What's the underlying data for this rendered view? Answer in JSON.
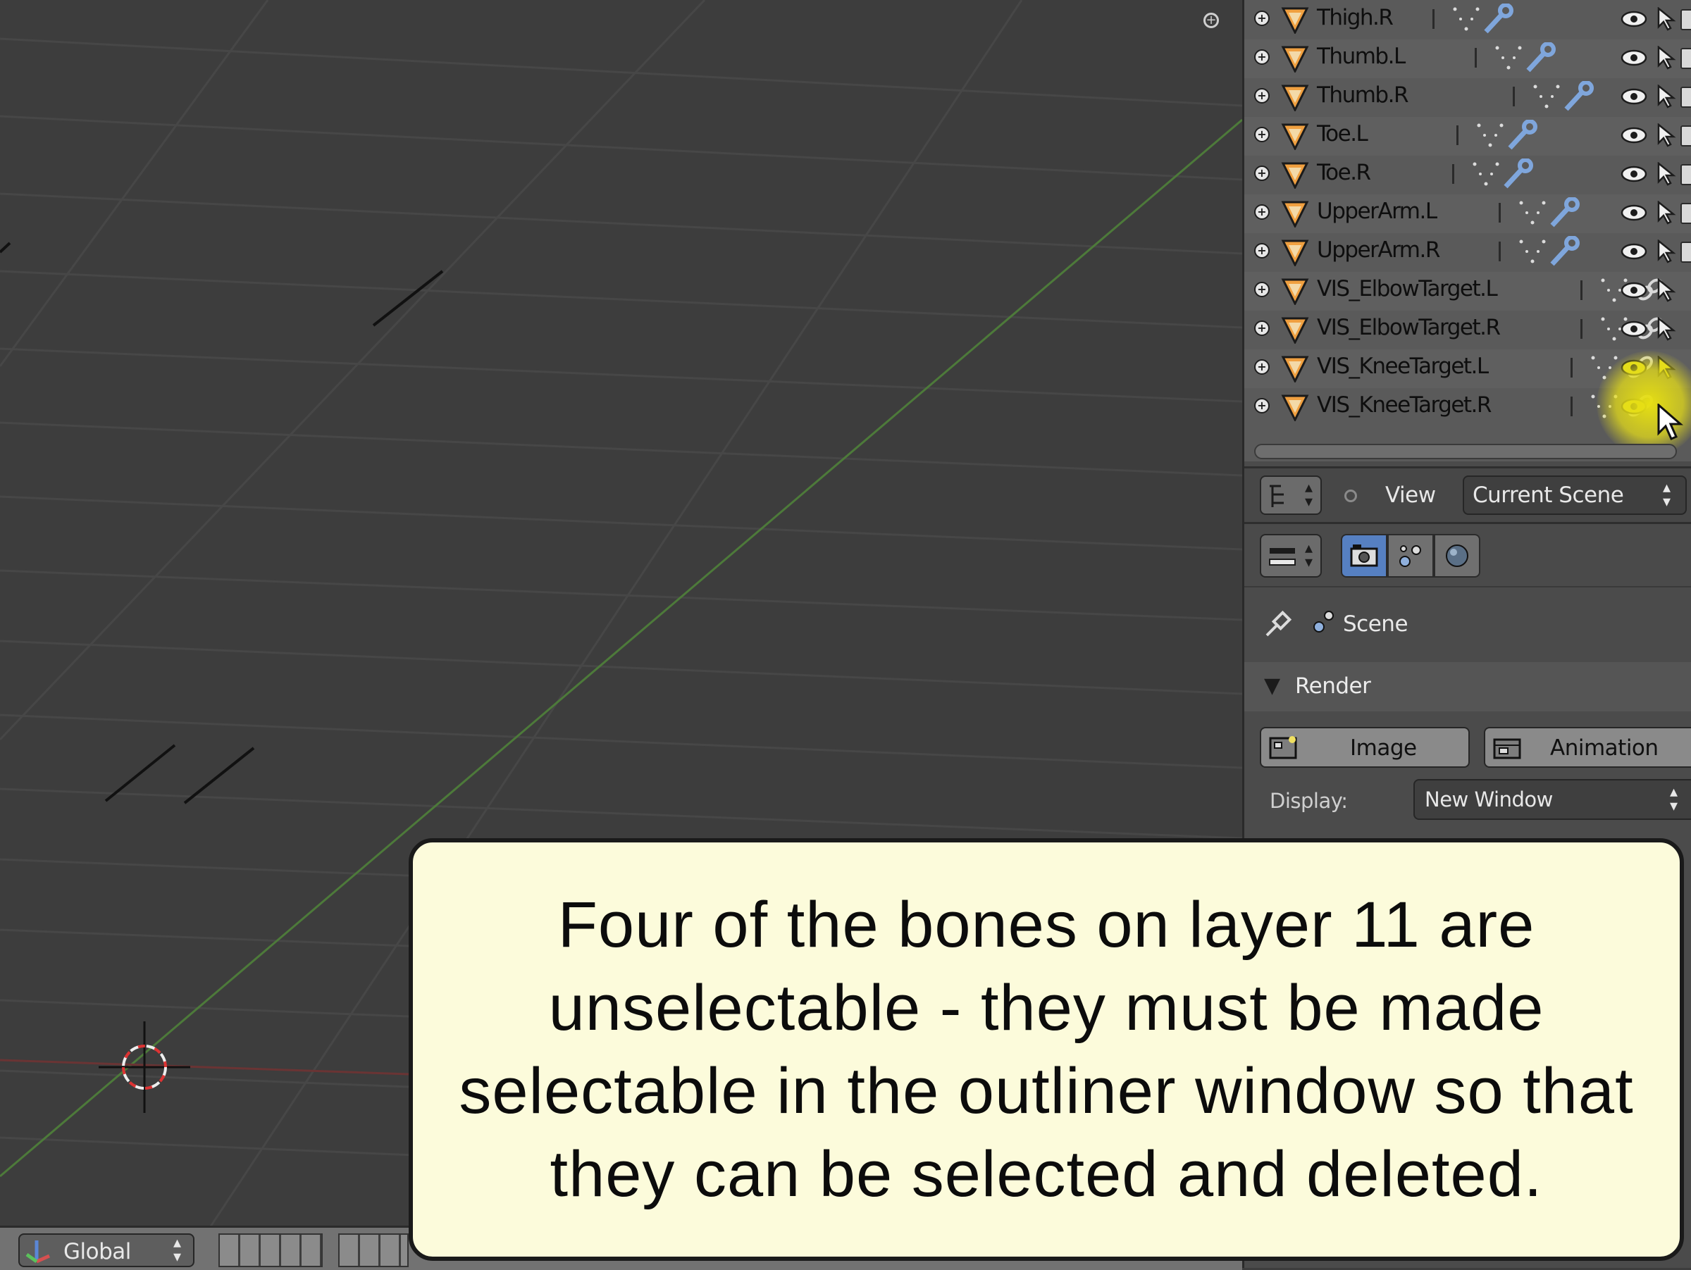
{
  "outliner": {
    "rows": [
      {
        "label": "Thigh.R",
        "restrict": "visible"
      },
      {
        "label": "Thumb.L",
        "restrict": "visible"
      },
      {
        "label": "Thumb.R",
        "restrict": "visible"
      },
      {
        "label": "Toe.L",
        "restrict": "visible"
      },
      {
        "label": "Toe.R",
        "restrict": "visible"
      },
      {
        "label": "UpperArm.L",
        "restrict": "visible"
      },
      {
        "label": "UpperArm.R",
        "restrict": "visible"
      },
      {
        "label": "VIS_ElbowTarget.L",
        "restrict": "visible"
      },
      {
        "label": "VIS_ElbowTarget.R",
        "restrict": "visible"
      },
      {
        "label": "VIS_KneeTarget.L",
        "restrict": "highlighted"
      },
      {
        "label": "VIS_KneeTarget.R",
        "restrict": "highlighted"
      }
    ],
    "header": {
      "view_label": "View",
      "display_mode": "Current Scene"
    }
  },
  "properties": {
    "context": "Scene",
    "panel_title": "Render",
    "image_button": "Image",
    "animation_button": "Animation",
    "display_label": "Display:",
    "display_value": "New Window"
  },
  "viewport_header": {
    "orientation": "Global"
  },
  "caption": {
    "text": "Four of the bones on layer 11 are unselectable - they must be made selectable in the outliner window so that they can be selected and deleted."
  },
  "colors": {
    "viewport_bg": "#3d3d3d",
    "caption_bg": "#fcfbdb",
    "active_tab": "#5680c2",
    "cursor_highlight": "#e6df12",
    "x_axis": "#7a2e2e",
    "y_axis": "#4d7a3a"
  }
}
